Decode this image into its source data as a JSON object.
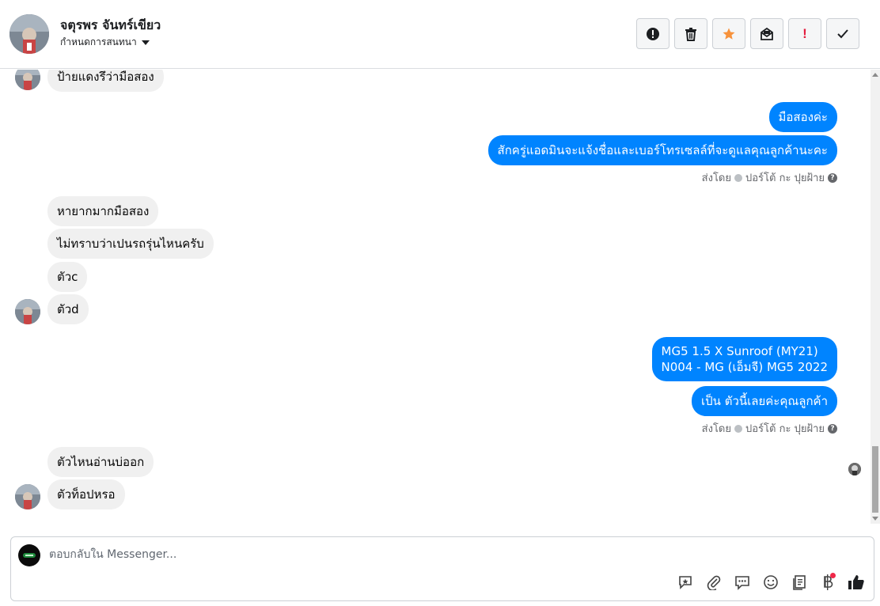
{
  "header": {
    "contact_name": "จตุรพร จันทร์เขียว",
    "assign_label": "กำหนดการสนทนา",
    "actions": [
      {
        "name": "report-spam-icon"
      },
      {
        "name": "trash-icon"
      },
      {
        "name": "star-icon"
      },
      {
        "name": "mark-unread-icon"
      },
      {
        "name": "follow-up-icon",
        "glyph": "!"
      },
      {
        "name": "done-check-icon"
      }
    ],
    "colors": {
      "star": "#f7923b",
      "followup": "#e41e3f"
    }
  },
  "messages": {
    "m1": "ป้ายแดงรึว่ามือสอง",
    "m2": "มือสองค่ะ",
    "m3": "สักครู่แอดมินจะแจ้งชื่อและเบอร์โทรเซลล์ที่จะดูแลคุณลูกค้านะคะ",
    "sent_by_1": {
      "prefix": "ส่งโดย",
      "name": "ปอร์โต้ กะ ปุยฝ้าย",
      "help": "?"
    },
    "m4": "หายากมากมือสอง",
    "m5": "ไม่ทราบว่าเปนรถรุ่นไหนครับ",
    "m6": "ตัวc",
    "m7": "ตัวd",
    "m8_line1": "MG5 1.5 X Sunroof (MY21)",
    "m8_line2": "N004 - MG (เอ็มจี) MG5 2022",
    "m9": "เป็น ตัวนี้เลยค่ะคุณลูกค้า",
    "sent_by_2": {
      "prefix": "ส่งโดย",
      "name": "ปอร์โต้ กะ ปุยฝ้าย",
      "help": "?"
    },
    "m10": "ตัวไหนอ่านบ่ออก",
    "m11": "ตัวท็อปหรอ"
  },
  "composer": {
    "placeholder": "ตอบกลับใน Messenger...",
    "tools": [
      "saved-reply-icon",
      "attachment-icon",
      "message-bubble-icon",
      "emoji-icon",
      "notes-icon",
      "baht-payment-icon",
      "thumbs-up-icon"
    ]
  },
  "colors": {
    "outgoing": "#0084ff",
    "incoming": "#f0f0f0"
  }
}
